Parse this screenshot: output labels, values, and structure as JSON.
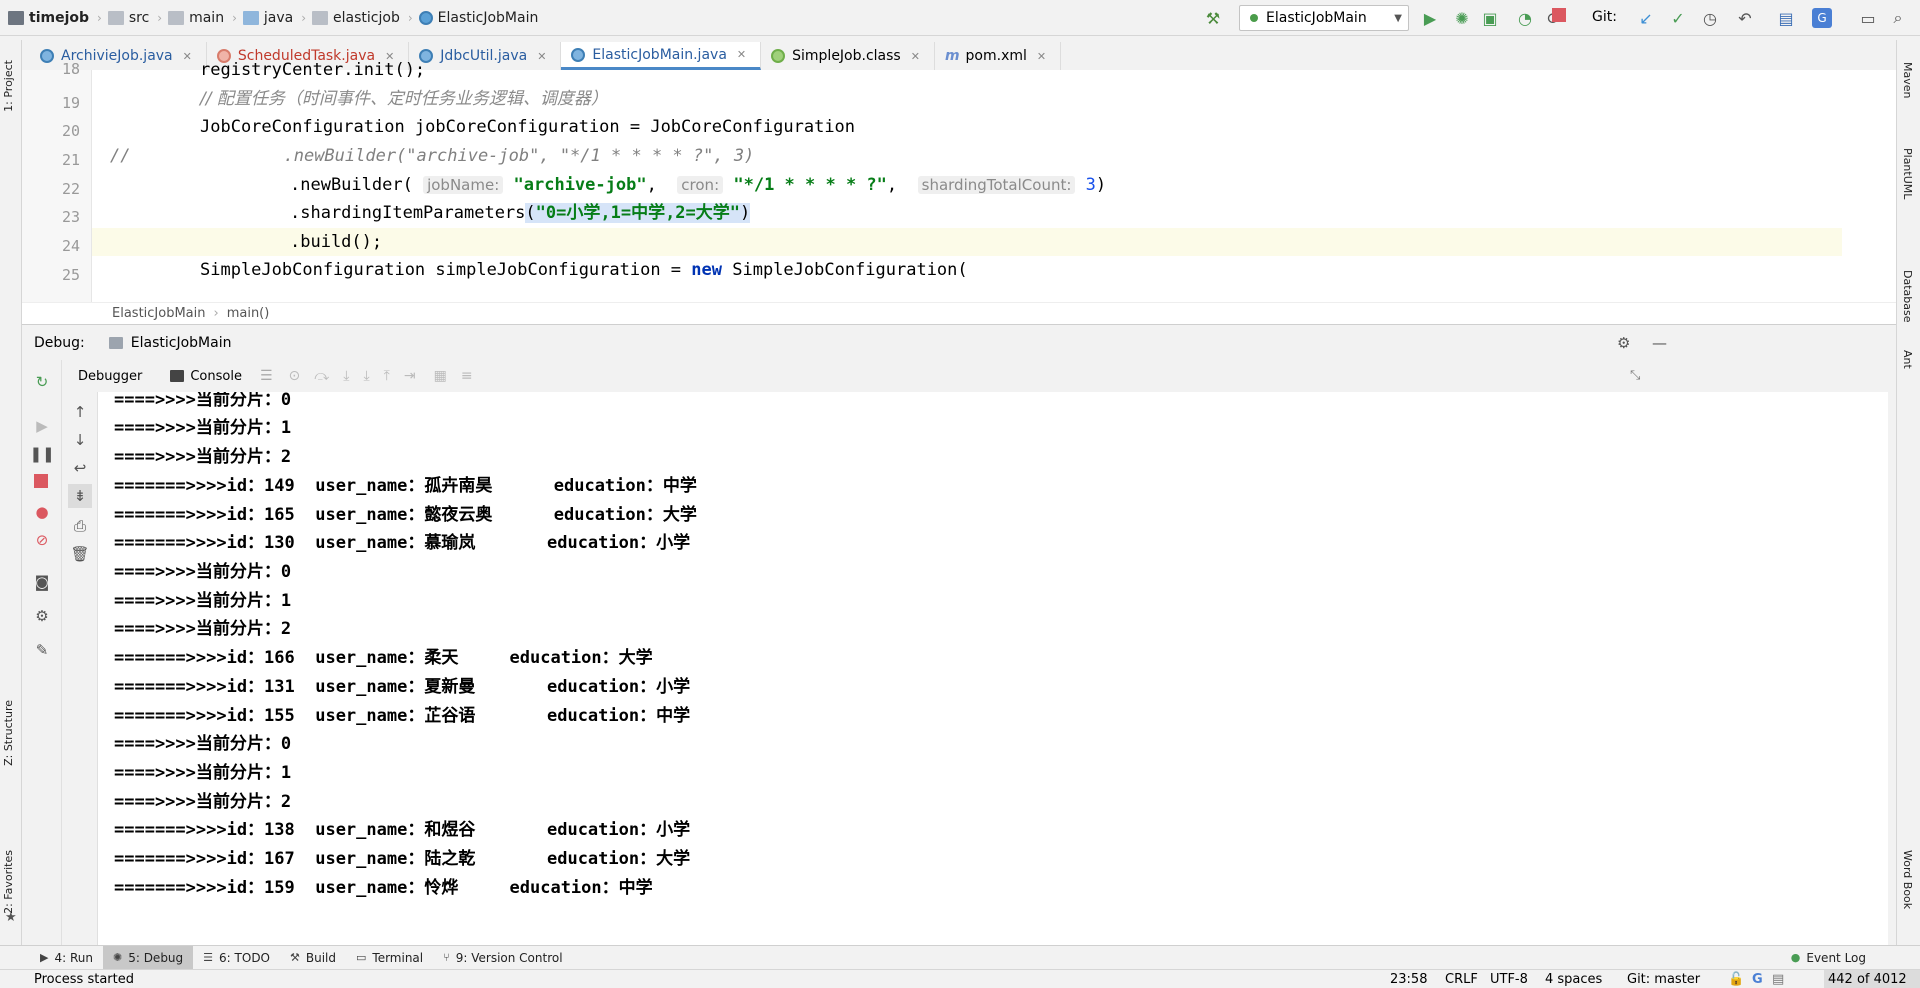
{
  "breadcrumb": [
    "timejob",
    "src",
    "main",
    "java",
    "elasticjob",
    "ElasticJobMain"
  ],
  "run_config": "ElasticJobMain",
  "git_label": "Git:",
  "tabs": [
    {
      "label": "ArchivieJob.java",
      "color": "#5aa0d6"
    },
    {
      "label": "ScheduledTask.java",
      "color": "#d87c6b"
    },
    {
      "label": "JdbcUtil.java",
      "color": "#5aa0d6"
    },
    {
      "label": "ElasticJobMain.java",
      "color": "#5aa0d6"
    },
    {
      "label": "SimpleJob.class",
      "color": "#6fae4a"
    },
    {
      "label": "pom.xml",
      "color": "#6b8fd0"
    }
  ],
  "left_tools": [
    "1: Project",
    "Z: Structure",
    "2: Favorites"
  ],
  "right_tools": [
    "Maven",
    "PlantUML",
    "Database",
    "Ant",
    "Word Book"
  ],
  "editor": {
    "line_numbers": [
      "18",
      "19",
      "20",
      "21",
      "22",
      "23",
      "24",
      "25"
    ],
    "line18": "registryCenter.init();",
    "line19_comment": "// 配置任务（时间事件、定时任务业务逻辑、调度器）",
    "line20": "JobCoreConfiguration jobCoreConfiguration = JobCoreConfiguration",
    "line21_prefix": "//",
    "line21_code": ".newBuilder(\"archive-job\", \"*/1 * * * * ?\", 3)",
    "line22_call": ".newBuilder(",
    "line22_hint1": "jobName:",
    "line22_str1": "\"archive-job\"",
    "line22_hint2": "cron:",
    "line22_str2": "\"*/1 * * * * ?\"",
    "line22_hint3": "shardingTotalCount:",
    "line22_num": "3",
    "line22_end": ")",
    "line23_call": ".shardingItemParameters",
    "line23_str": "\"0=小学,1=中学,2=大学\"",
    "line24": ".build();",
    "line25_prefix": "SimpleJobConfiguration simpleJobConfiguration = ",
    "line25_kw": "new",
    "line25_suffix": " SimpleJobConfiguration("
  },
  "editor_breadcrumb": [
    "ElasticJobMain",
    "main()"
  ],
  "debug": {
    "label": "Debug:",
    "session": "ElasticJobMain",
    "tab_debugger": "Debugger",
    "tab_console": "Console"
  },
  "console_lines": [
    "====>>>>当前分片：0",
    "====>>>>当前分片：1",
    "====>>>>当前分片：2",
    "=======>>>>id：149  user_name：孤卉南昊      education：中学",
    "=======>>>>id：165  user_name：懿夜云奥      education：大学",
    "=======>>>>id：130  user_name：慕瑜岚       education：小学",
    "====>>>>当前分片：0",
    "====>>>>当前分片：1",
    "====>>>>当前分片：2",
    "=======>>>>id：166  user_name：柔天     education：大学",
    "=======>>>>id：131  user_name：夏新曼       education：小学",
    "=======>>>>id：155  user_name：芷谷语       education：中学",
    "====>>>>当前分片：0",
    "====>>>>当前分片：1",
    "====>>>>当前分片：2",
    "=======>>>>id：138  user_name：和煜谷       education：小学",
    "=======>>>>id：167  user_name：陆之乾       education：大学",
    "=======>>>>id：159  user_name：怜烨     education：中学"
  ],
  "tool_windows": [
    {
      "label": "4: Run",
      "active": false
    },
    {
      "label": "5: Debug",
      "active": true
    },
    {
      "label": "6: TODO",
      "active": false
    },
    {
      "label": "Build",
      "active": false
    },
    {
      "label": "Terminal",
      "active": false
    },
    {
      "label": "9: Version Control",
      "active": false
    }
  ],
  "event_log": "Event Log",
  "status": {
    "message": "Process started",
    "position": "23:58",
    "line_sep": "CRLF",
    "encoding": "UTF-8",
    "indent": "4 spaces",
    "git_branch": "Git: master",
    "memory": "442 of 4012"
  }
}
